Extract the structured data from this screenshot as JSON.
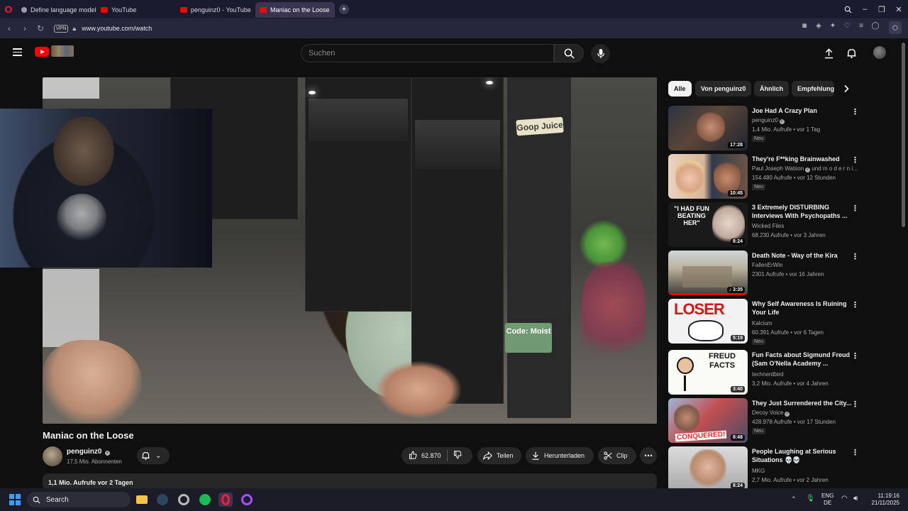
{
  "browser": {
    "tabs": [
      {
        "title": "Define language model",
        "icon": "chatgpt-icon",
        "color": "#9a9ab0"
      },
      {
        "title": "YouTube",
        "icon": "youtube-icon",
        "color": "#ff0000"
      },
      {
        "title": "penguinz0 - YouTube",
        "icon": "youtube-icon",
        "color": "#ff0000"
      },
      {
        "title": "Maniac on the Loose",
        "icon": "youtube-icon",
        "color": "#ff0000"
      }
    ],
    "url": "www.youtube.com/watch",
    "vpn_label": "VPN"
  },
  "youtube": {
    "search_placeholder": "Suchen",
    "video": {
      "title": "Maniac on the Loose",
      "channel": "penguinz0",
      "subscribers": "17,5 Mio. Abonnenten",
      "likes": "62.870",
      "share_label": "Teilen",
      "download_label": "Herunterladen",
      "clip_label": "Clip",
      "views_date": "1,1 Mio. Aufrufe  vor 2 Tagen",
      "sign_text_1": "Goop Juice",
      "sign_text_2": "Code: Moist"
    },
    "chips": [
      "Alle",
      "Von penguinz0",
      "Ähnlich",
      "Empfehlung"
    ],
    "recommendations": [
      {
        "title": "Joe Had A Crazy Plan",
        "channel": "penguinz0",
        "verified": true,
        "meta": "1,4 Mio. Aufrufe • vor 1 Tag",
        "badge": "Neu",
        "duration": "17:28"
      },
      {
        "title": "They're F**king Brainwashed",
        "channel": "Paul Joseph Watson",
        "verified": true,
        "channel_extra": "und m o d e r n i...",
        "meta": "154.480 Aufrufe • vor 12 Stunden",
        "badge": "Neu",
        "duration": "10:45"
      },
      {
        "title": "3 Extremely DISTURBING Interviews With Psychopaths ...",
        "channel": "Wicked Files",
        "verified": false,
        "meta": "68.230 Aufrufe • vor 3 Jahren",
        "badge": "",
        "duration": "8:24",
        "thumb_text": "\"I HAD FUN BEATING HER\""
      },
      {
        "title": "Death Note - Way of the Kira",
        "channel": "FallenErWin",
        "verified": false,
        "meta": "2301 Aufrufe • vor 16 Jahren",
        "badge": "",
        "duration": "♪ 3:35"
      },
      {
        "title": "Why Self Awareness Is Ruining Your Life",
        "channel": "Kalcium",
        "verified": false,
        "meta": "60.391 Aufrufe • vor 6 Tagen",
        "badge": "Neu",
        "duration": "5:19",
        "thumb_text": "LOSER"
      },
      {
        "title": "Fun Facts about Sigmund Freud (Sam O'Nella Academy ...",
        "channel": "technerdbird",
        "verified": false,
        "meta": "3,2 Mio. Aufrufe • vor 4 Jahren",
        "badge": "",
        "duration": "3:40",
        "thumb_text": "FREUD FACTS"
      },
      {
        "title": "They Just Surrendered the City...",
        "channel": "Decoy Voice",
        "verified": true,
        "meta": "428.978 Aufrufe • vor 17 Stunden",
        "badge": "Neu",
        "duration": "8:48",
        "thumb_text": "CONQUERED!"
      },
      {
        "title": "People Laughing at Serious Situations 💀💀",
        "channel": "MKG",
        "verified": false,
        "meta": "2,7 Mio. Aufrufe • vor 2 Jahren",
        "badge": "",
        "duration": "8:24"
      }
    ]
  },
  "taskbar": {
    "search_label": "Search",
    "lang": "ENG",
    "region": "DE",
    "time": "11:19:16",
    "date": "21/11/2025"
  },
  "colors": {
    "accent": "#ff0000",
    "bg": "#0f0f0f",
    "chip_bg": "#272727"
  }
}
